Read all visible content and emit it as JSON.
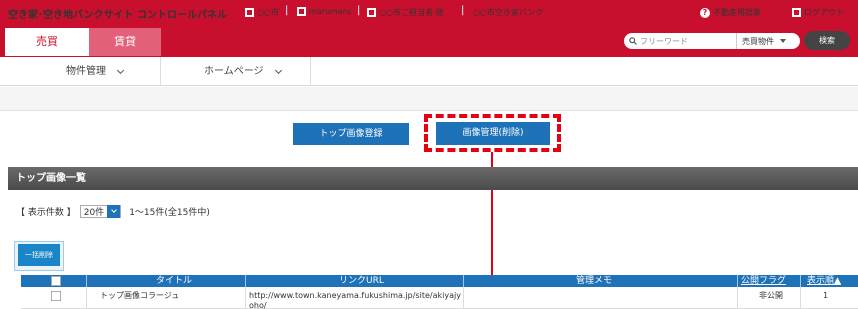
{
  "header": {
    "site_title": "空き家･空き地バンクサイト コントロールパネル",
    "org": "○○市",
    "user": "marumaru",
    "person": "○○市ご担当者 様",
    "bank": "○○市空き家バンク",
    "glossary": "不動産用語集",
    "logout": "ログアウト",
    "separator": "|"
  },
  "tabs": [
    {
      "label": "売買",
      "active": true
    },
    {
      "label": "賃貸",
      "active": false
    }
  ],
  "search": {
    "placeholder": "フリーワード",
    "category": "売買物件",
    "button": "検索"
  },
  "nav": [
    {
      "label": "物件管理"
    },
    {
      "label": "ホームページ"
    }
  ],
  "actions": {
    "register": "トップ画像登録",
    "manage": "画像管理(削除)"
  },
  "section": {
    "title": "トップ画像一覧",
    "count_label": "【 表示件数 】",
    "count_value": "20件",
    "range": "1〜15件(全15件中)",
    "bulk_delete": "一括削除"
  },
  "table": {
    "columns": [
      "タイトル",
      "リンクURL",
      "管理メモ",
      "公開フラグ",
      "表示順▲"
    ],
    "rows": [
      {
        "title": "トップ画像コラージュ",
        "url": "http://www.town.kaneyama.fukushima.jp/site/akiyajyoho/",
        "memo": "",
        "flag": "非公開",
        "order": "1"
      }
    ]
  },
  "colors": {
    "brand_red": "#c8102e",
    "tab_inactive": "#e2607a",
    "button_blue": "#1e72b8",
    "highlight_red": "#e60012"
  }
}
